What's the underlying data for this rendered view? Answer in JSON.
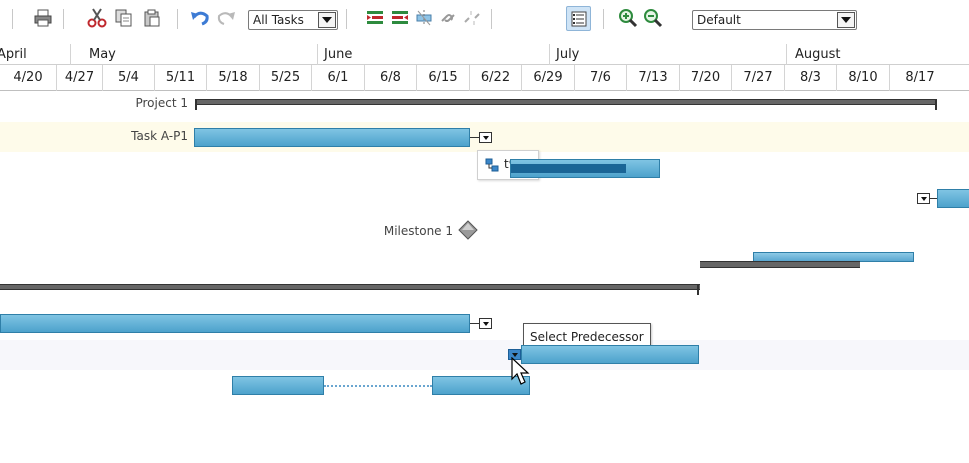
{
  "toolbar": {
    "filter_combo_value": "All Tasks",
    "view_combo_value": "Default"
  },
  "timeline": {
    "months": [
      "April",
      "May",
      "June",
      "July",
      "August"
    ],
    "weeks": [
      "4/20",
      "4/27",
      "5/4",
      "5/11",
      "5/18",
      "5/25",
      "6/1",
      "6/8",
      "6/15",
      "6/22",
      "6/29",
      "7/6",
      "7/13",
      "7/20",
      "7/27",
      "8/3",
      "8/10",
      "8/17"
    ]
  },
  "rows": {
    "project_label": "Project 1",
    "task_label": "Task A-P1",
    "milestone_label": "Milestone 1"
  },
  "popup": {
    "item_label": "t9"
  },
  "tooltip": {
    "text": "Select Predecessor"
  },
  "colors": {
    "task_bar": "#6bb6dc",
    "task_border": "#2f7fa8",
    "progress": "#1a6596",
    "summary_bar": "#666666",
    "selected_row": "#fefbea",
    "alt_row": "#f7f7fb"
  }
}
